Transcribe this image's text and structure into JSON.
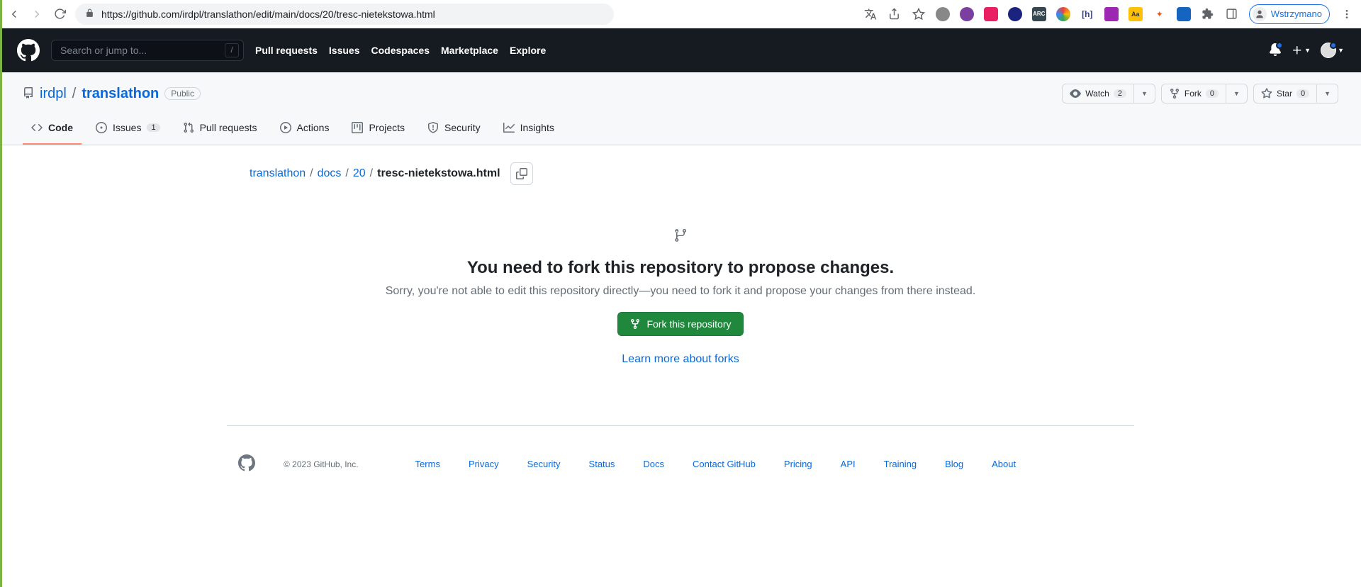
{
  "browser": {
    "url": "https://github.com/irdpl/translathon/edit/main/docs/20/tresc-nietekstowa.html",
    "profile_label": "Wstrzymano"
  },
  "gh_header": {
    "search_placeholder": "Search or jump to...",
    "nav": {
      "pulls": "Pull requests",
      "issues": "Issues",
      "codespaces": "Codespaces",
      "marketplace": "Marketplace",
      "explore": "Explore"
    }
  },
  "repo": {
    "owner": "irdpl",
    "name": "translathon",
    "visibility": "Public",
    "watch_label": "Watch",
    "watch_count": "2",
    "fork_label": "Fork",
    "fork_count": "0",
    "star_label": "Star",
    "star_count": "0"
  },
  "tabs": {
    "code": "Code",
    "issues": "Issues",
    "issues_count": "1",
    "pulls": "Pull requests",
    "actions": "Actions",
    "projects": "Projects",
    "security": "Security",
    "insights": "Insights"
  },
  "breadcrumb": {
    "root": "translathon",
    "p1": "docs",
    "p2": "20",
    "file": "tresc-nietekstowa.html"
  },
  "notice": {
    "title": "You need to fork this repository to propose changes.",
    "body": "Sorry, you're not able to edit this repository directly—you need to fork it and propose your changes from there instead.",
    "button": "Fork this repository",
    "learn": "Learn more about forks"
  },
  "footer": {
    "copyright": "© 2023 GitHub, Inc.",
    "links": {
      "terms": "Terms",
      "privacy": "Privacy",
      "security": "Security",
      "status": "Status",
      "docs": "Docs",
      "contact": "Contact GitHub",
      "pricing": "Pricing",
      "api": "API",
      "training": "Training",
      "blog": "Blog",
      "about": "About"
    }
  }
}
